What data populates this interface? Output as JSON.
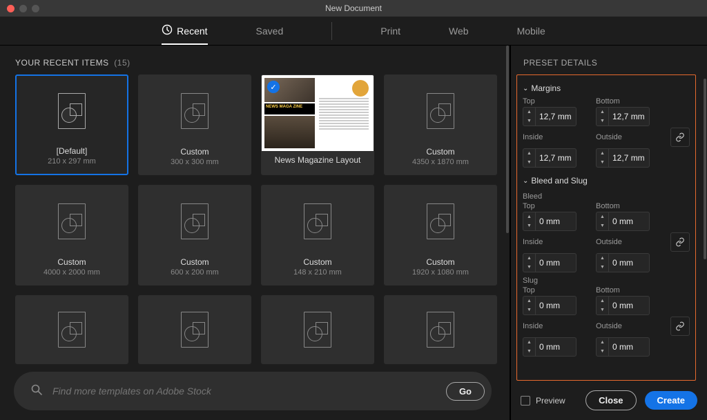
{
  "window": {
    "title": "New Document"
  },
  "tabs": {
    "recent": "Recent",
    "saved": "Saved",
    "print": "Print",
    "web": "Web",
    "mobile": "Mobile"
  },
  "recent": {
    "heading": "YOUR RECENT ITEMS",
    "count": "(15)",
    "items": [
      {
        "label": "[Default]",
        "sub": "210 x 297 mm"
      },
      {
        "label": "Custom",
        "sub": "300 x 300 mm"
      },
      {
        "label": "News Magazine Layout",
        "sub": ""
      },
      {
        "label": "Custom",
        "sub": "4350 x 1870 mm"
      },
      {
        "label": "Custom",
        "sub": "4000 x 2000 mm"
      },
      {
        "label": "Custom",
        "sub": "600 x 200 mm"
      },
      {
        "label": "Custom",
        "sub": "148 x 210 mm"
      },
      {
        "label": "Custom",
        "sub": "1920 x 1080 mm"
      },
      {
        "label": "",
        "sub": ""
      },
      {
        "label": "",
        "sub": ""
      },
      {
        "label": "",
        "sub": ""
      },
      {
        "label": "",
        "sub": ""
      }
    ]
  },
  "search": {
    "placeholder": "Find more templates on Adobe Stock",
    "go": "Go"
  },
  "panel": {
    "heading": "PRESET DETAILS",
    "margins": {
      "title": "Margins",
      "top_label": "Top",
      "bottom_label": "Bottom",
      "inside_label": "Inside",
      "outside_label": "Outside",
      "top": "12,7 mm",
      "bottom": "12,7 mm",
      "inside": "12,7 mm",
      "outside": "12,7 mm"
    },
    "bleedslug_title": "Bleed and Slug",
    "bleed": {
      "title": "Bleed",
      "top_label": "Top",
      "bottom_label": "Bottom",
      "inside_label": "Inside",
      "outside_label": "Outside",
      "top": "0 mm",
      "bottom": "0 mm",
      "inside": "0 mm",
      "outside": "0 mm"
    },
    "slug": {
      "title": "Slug",
      "top_label": "Top",
      "bottom_label": "Bottom",
      "inside_label": "Inside",
      "outside_label": "Outside",
      "top": "0 mm",
      "bottom": "0 mm",
      "inside": "0 mm",
      "outside": "0 mm"
    }
  },
  "footer": {
    "preview": "Preview",
    "close": "Close",
    "create": "Create"
  },
  "mag": {
    "brand": "NEWS MAGA ZINE"
  }
}
